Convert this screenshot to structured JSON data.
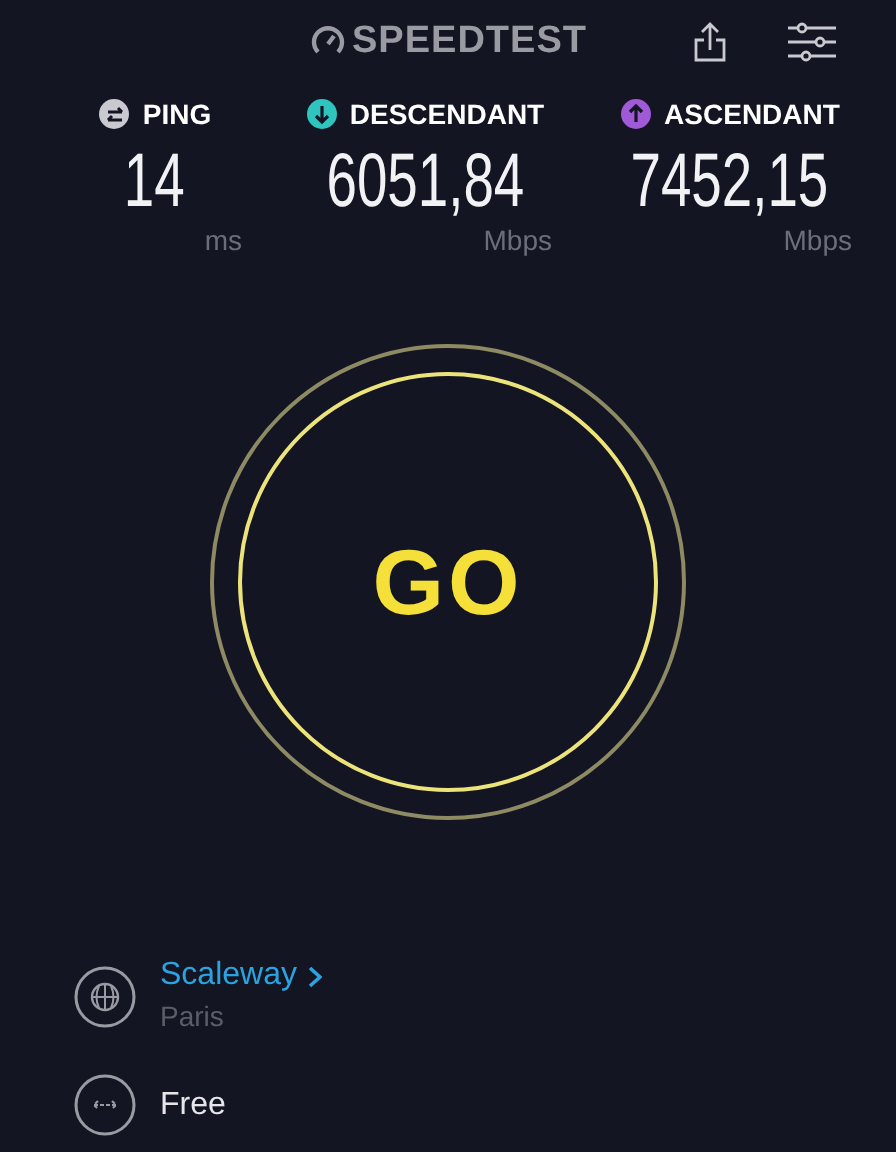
{
  "header": {
    "logo": "SPEEDTEST"
  },
  "metrics": [
    {
      "label": "PING",
      "value": "14",
      "unit": "ms",
      "color": "#c9c9cf",
      "kind": "ping"
    },
    {
      "label": "DESCENDANT",
      "value": "6051,84",
      "unit": "Mbps",
      "color": "#2fc4bd",
      "kind": "download"
    },
    {
      "label": "ASCENDANT",
      "value": "7452,15",
      "unit": "Mbps",
      "color": "#a05ad8",
      "kind": "upload"
    }
  ],
  "go_button": {
    "label": "GO"
  },
  "server": {
    "name": "Scaleway",
    "location": "Paris"
  },
  "connection": {
    "label": "Free"
  }
}
